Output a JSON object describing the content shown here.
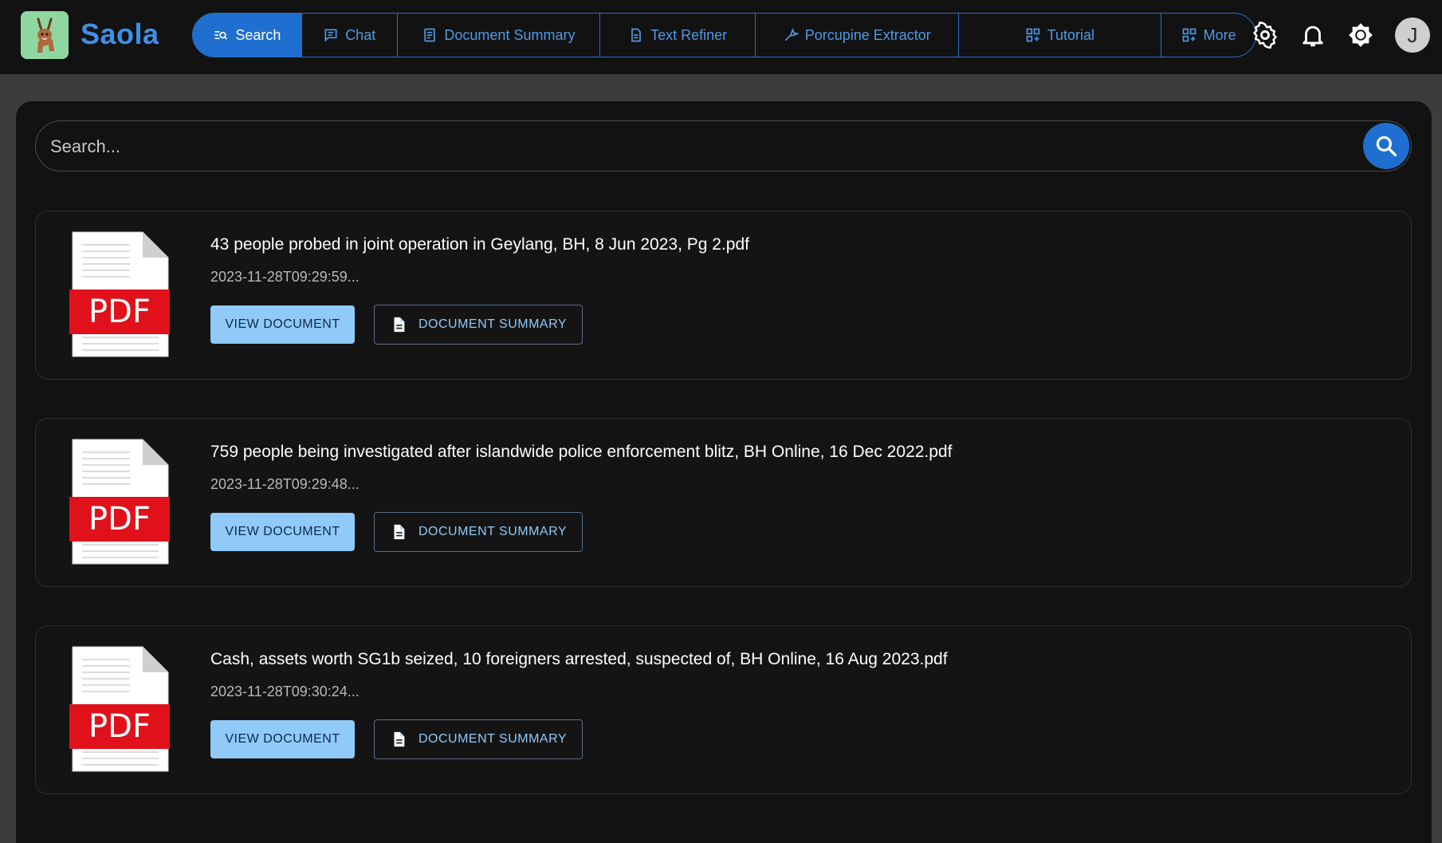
{
  "app": {
    "name": "Saola"
  },
  "nav": {
    "items": [
      {
        "label": "Search",
        "icon": "search-list-icon",
        "active": true
      },
      {
        "label": "Chat",
        "icon": "chat-icon"
      },
      {
        "label": "Document Summary",
        "icon": "document-summary-icon"
      },
      {
        "label": "Text Refiner",
        "icon": "text-refiner-icon"
      },
      {
        "label": "Porcupine Extractor",
        "icon": "extractor-icon"
      },
      {
        "label": "Tutorial",
        "icon": "grid-icon"
      },
      {
        "label": "More",
        "icon": "grid-icon"
      }
    ]
  },
  "header_icons": [
    "settings-icon",
    "bell-icon",
    "brightness-icon"
  ],
  "user": {
    "avatar_initial": "J"
  },
  "search": {
    "placeholder": "Search..."
  },
  "results": [
    {
      "title": "43 people probed in joint operation in Geylang, BH, 8 Jun 2023, Pg 2.pdf",
      "date": "2023-11-28T09:29:59...",
      "file_type": "PDF",
      "view_label": "VIEW DOCUMENT",
      "summary_label": "DOCUMENT SUMMARY"
    },
    {
      "title": "759 people being investigated after islandwide police enforcement blitz, BH Online, 16 Dec 2022.pdf",
      "date": "2023-11-28T09:29:48...",
      "file_type": "PDF",
      "view_label": "VIEW DOCUMENT",
      "summary_label": "DOCUMENT SUMMARY"
    },
    {
      "title": "Cash, assets worth SG1b seized, 10 foreigners arrested, suspected of, BH Online, 16 Aug 2023.pdf",
      "date": "2023-11-28T09:30:24...",
      "file_type": "PDF",
      "view_label": "VIEW DOCUMENT",
      "summary_label": "DOCUMENT SUMMARY"
    }
  ],
  "colors": {
    "accent": "#1e6fcf",
    "brand_text": "#3f8fe6",
    "button_light": "#90caf9",
    "pdf_red": "#e0111b",
    "background": "#121212"
  }
}
